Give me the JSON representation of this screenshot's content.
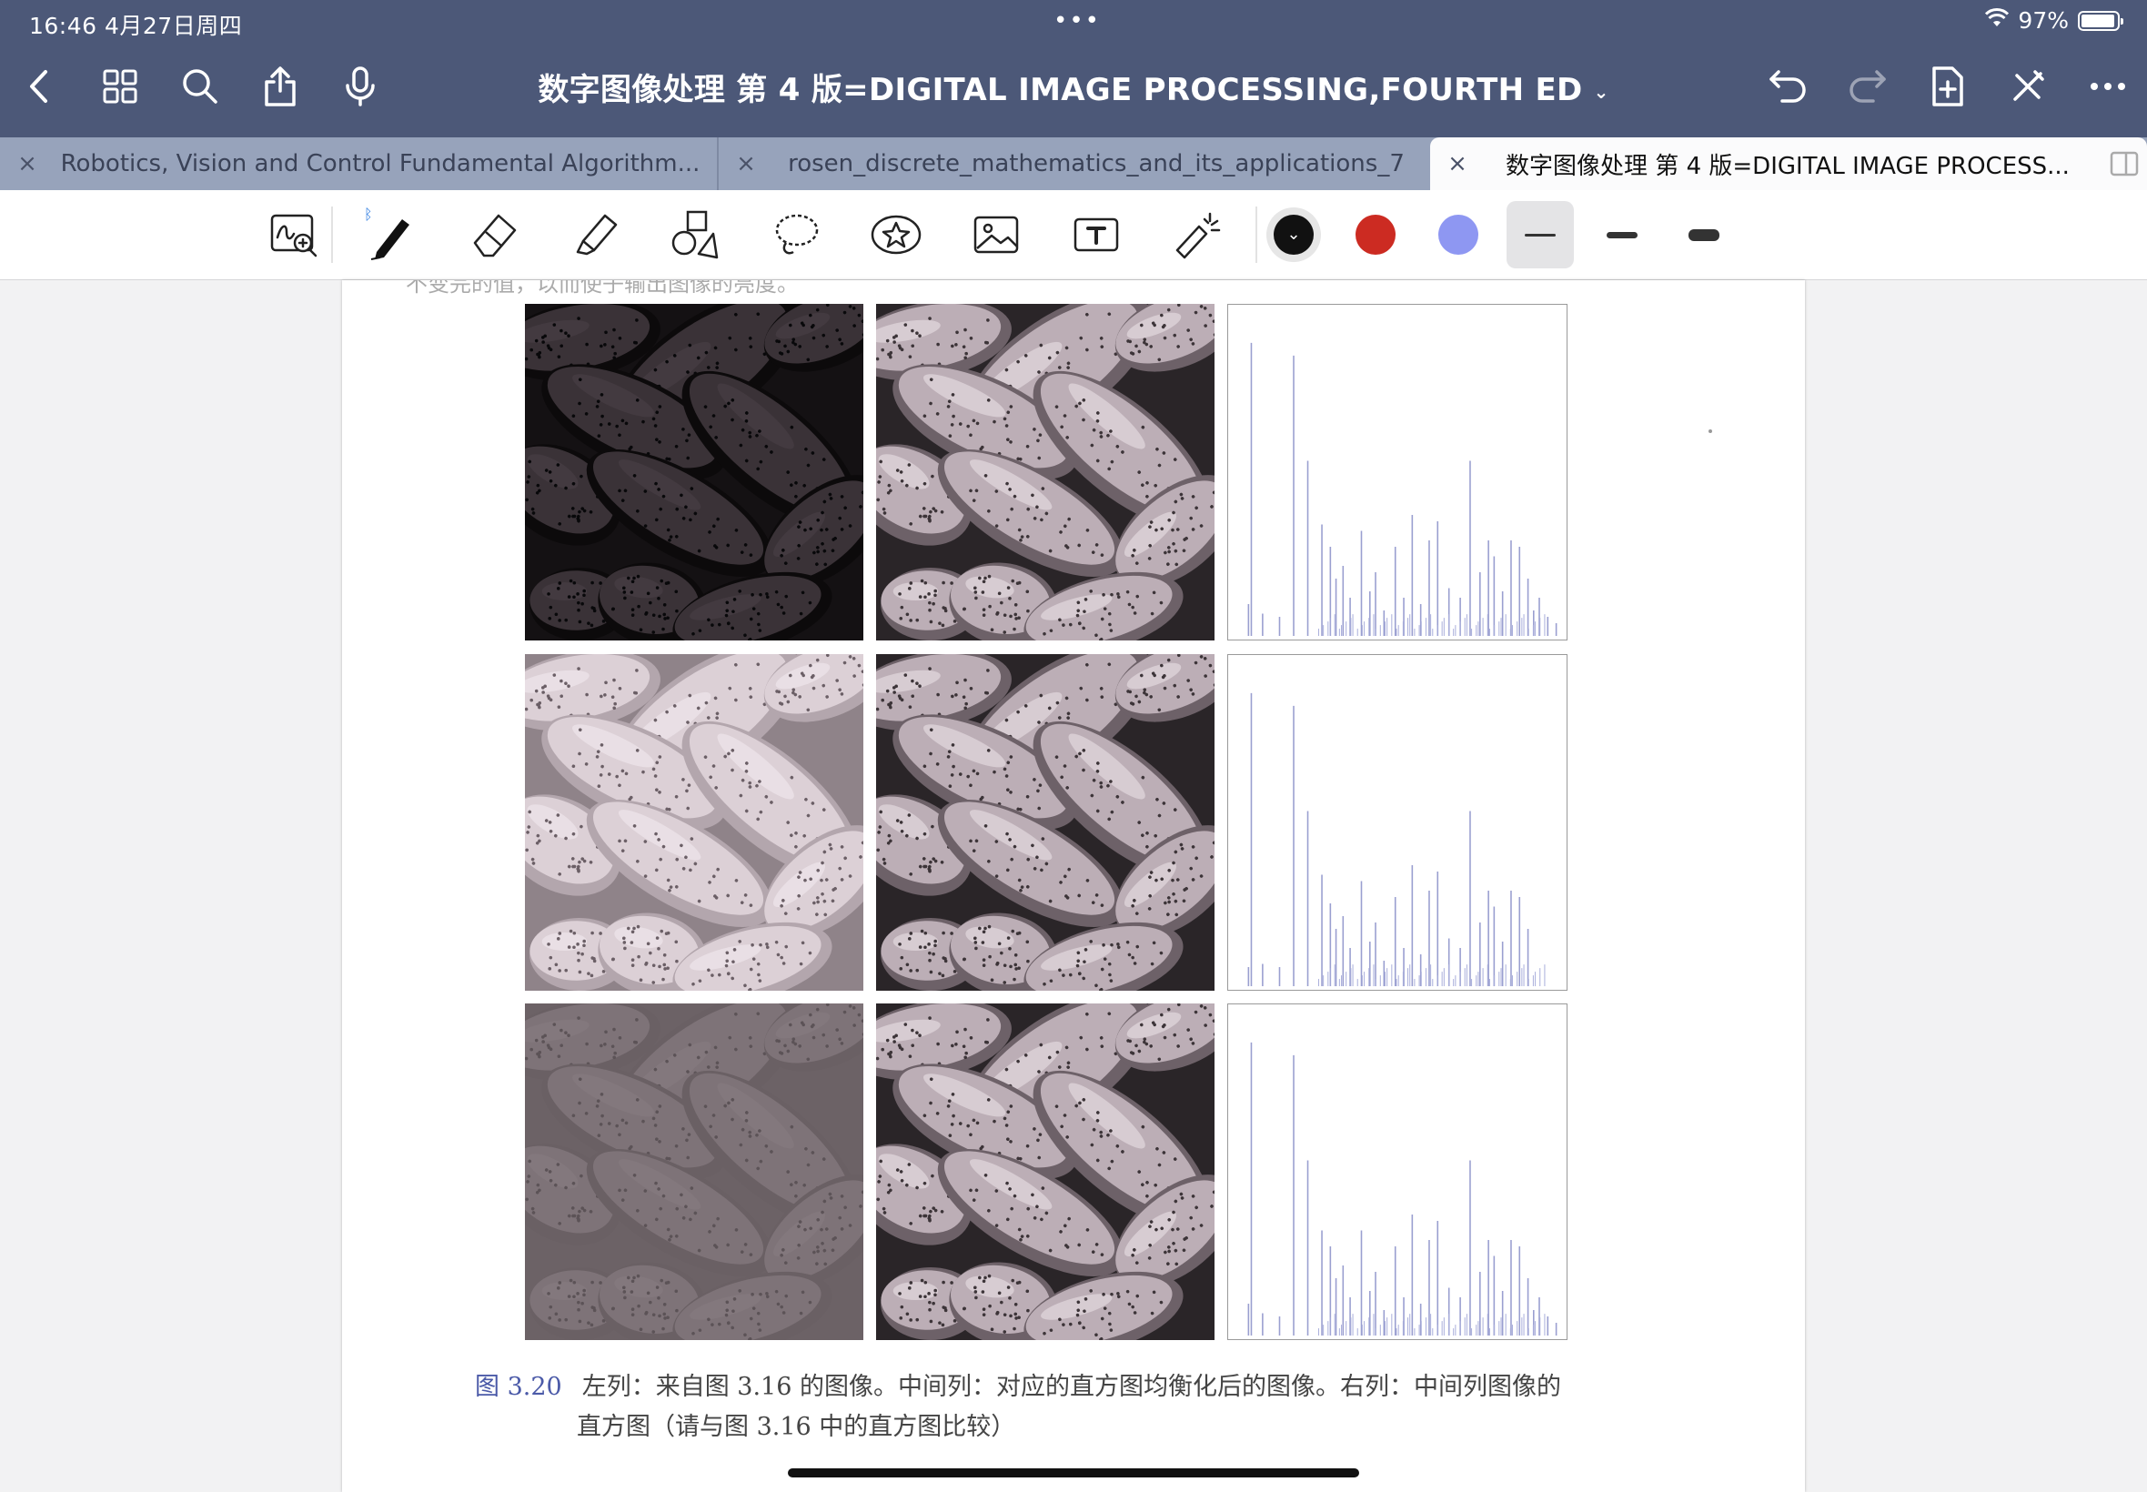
{
  "status_bar": {
    "time_date": "16:46   4月27日周四",
    "center_dots": "•••",
    "battery": "97%"
  },
  "toolbar": {
    "title": "数字图像处理  第 4 版=DIGITAL  IMAGE  PROCESSING,FOURTH  ED",
    "icons": [
      "back-icon",
      "grid-icon",
      "search-icon",
      "share-icon",
      "microphone-icon",
      "undo-icon",
      "redo-icon",
      "add-page-icon",
      "close-pen-icon",
      "more-icon"
    ]
  },
  "tabs": [
    {
      "label": "Robotics, Vision and Control Fundamental Algorithm...",
      "close": "×"
    },
    {
      "label": "rosen_discrete_mathematics_and_its_applications_7",
      "close": "×"
    },
    {
      "label": "数字图像处理  第 4 版=DIGITAL  IMAGE  PROCESS...",
      "close": "×"
    }
  ],
  "tools": {
    "items": [
      "zoom-window",
      "pen",
      "eraser",
      "highlighter",
      "shapes",
      "lasso",
      "sticker",
      "image",
      "text",
      "laser-pointer"
    ],
    "colors": [
      "#111111",
      "#cc2b22",
      "#8e97f2"
    ],
    "selected_color": "#111111",
    "selected_thickness": 0
  },
  "page": {
    "cut_text": "不变完的值，以而使子输出图像的亮度。",
    "figure": {
      "rows": [
        "dark",
        "light",
        "low-contrast"
      ],
      "columns": [
        "original",
        "equalized",
        "histogram"
      ]
    },
    "caption_number": "图 3.20",
    "caption_line1": "左列：来自图 3.16 的图像。中间列：对应的直方图均衡化后的图像。右列：中间列图像的",
    "caption_line2": "直方图（请与图 3.16 中的直方图比较）"
  }
}
